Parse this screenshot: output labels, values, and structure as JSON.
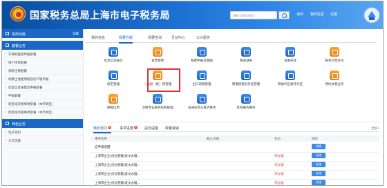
{
  "header": {
    "site_title": "国家税务总局上海市电子税务局",
    "search_placeholder": "请输入搜索关键字",
    "user_links": [
      "退出",
      "我的信息",
      "设置"
    ]
  },
  "sidebar": {
    "section1": {
      "title": "常用功能",
      "setting": "设置"
    },
    "section2": {
      "title": "套餐业务",
      "items": [
        "车辆购置税申报套餐",
        "增户项目套餐",
        "清税注销套餐",
        "城镇土地使用税及房产税申报",
        "房屋信息采集及申报套餐",
        "申报套餐",
        "跨区域涉税事项套餐（本市跨区）",
        "跨区域涉税事项套餐（本市跨区）"
      ]
    },
    "section3": {
      "title": "特色业务",
      "items": [
        "电子资料",
        "大厅流量"
      ]
    }
  },
  "tabs": [
    "我的信息",
    "我要办税",
    "我要查询",
    "互动中心",
    "公众服务"
  ],
  "grid": [
    {
      "label": "综合信息报告",
      "color": "blue"
    },
    {
      "label": "发票使用",
      "color": "orange"
    },
    {
      "label": "税费申报及缴纳",
      "color": "blue"
    },
    {
      "label": "税收减免",
      "color": "blue"
    },
    {
      "label": "证明开具",
      "color": "blue"
    },
    {
      "label": "税务行政许可",
      "color": "orange"
    },
    {
      "label": "核定管理",
      "color": "blue"
    },
    {
      "label": "一般退（抵）税管理",
      "color": "orange"
    },
    {
      "label": "出口退税管理",
      "color": "blue"
    },
    {
      "label": "增值税抵扣凭证管理",
      "color": "blue"
    },
    {
      "label": "税收代征委托代征",
      "color": "blue"
    },
    {
      "label": "预约办税业务",
      "color": "orange"
    },
    {
      "label": "纳税信用",
      "color": "orange"
    },
    {
      "label": "涉税专业服务机构管理",
      "color": "blue"
    },
    {
      "label": "法律追责与救济事项",
      "color": "blue"
    },
    {
      "label": "其他服务事项",
      "color": "blue"
    }
  ],
  "panel": {
    "tabs": [
      {
        "label": "我的待办",
        "badge": "6"
      },
      {
        "label": "事项进度",
        "badge": "1"
      },
      {
        "label": "提示提醒",
        "badge": ""
      },
      {
        "label": "政策速递",
        "badge": ""
      }
    ],
    "more": "更多>",
    "headers": [
      "事项名称",
      "截止日期",
      "状态",
      "操作"
    ],
    "rows": [
      {
        "name": "自申报提醒",
        "status": "",
        "action": "详情"
      },
      {
        "name": "上海市企业(优化税额)发文办理...",
        "status": "未办理",
        "action": "办理"
      },
      {
        "name": "上海市企业(优化税额)发文办理...",
        "status": "未办理",
        "action": "办理"
      },
      {
        "name": "上海市企业(优化税额)发文办理...",
        "status": "未办理",
        "action": "办理"
      },
      {
        "name": "上海市企业(优化税额)发文办理...",
        "status": "未办理",
        "action": "办理"
      }
    ]
  }
}
